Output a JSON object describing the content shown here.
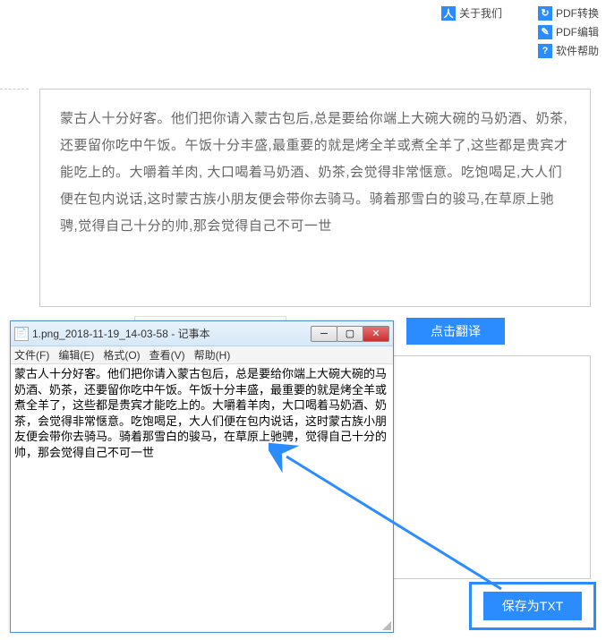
{
  "topButtons": {
    "left": {
      "icon": "人",
      "label": "关于我们"
    },
    "right": [
      {
        "icon": "↻",
        "label": "PDF转换"
      },
      {
        "icon": "✎",
        "label": "PDF编辑"
      },
      {
        "icon": "?",
        "label": "软件帮助"
      }
    ]
  },
  "mainText": "蒙古人十分好客。他们把你请入蒙古包后,总是要给你端上大碗大碗的马奶酒、奶茶,还要留你吃中午饭。午饭十分丰盛,最重要的就是烤全羊或煮全羊了,这些都是贵宾才能吃上的。大嚼着羊肉, 大口喝着马奶酒、奶茶,会觉得非常惬意。吃饱喝足,大人们便在包内说话,这时蒙古族小朋友便会带你去骑马。骑着那雪白的骏马,在草原上驰骋,觉得自己十分的帅,那会觉得自己不可一世",
  "translateBtn": "点击翻译",
  "saveBtn": "保存为TXT",
  "notepad": {
    "title": "1.png_2018-11-19_14-03-58 - 记事本",
    "menus": [
      "文件(F)",
      "编辑(E)",
      "格式(O)",
      "查看(V)",
      "帮助(H)"
    ],
    "content": "蒙古人十分好客。他们把你请入蒙古包后，总是要给你端上大碗大碗的马奶酒、奶茶，还要留你吃中午饭。午饭十分丰盛，最重要的就是烤全羊或煮全羊了，这些都是贵宾才能吃上的。大嚼着羊肉，大口喝着马奶酒、奶茶，会觉得非常惬意。吃饱喝足，大人们便在包内说话，这时蒙古族小朋友便会带你去骑马。骑着那雪白的骏马，在草原上驰骋，觉得自己十分的帅，那会觉得自己不可一世"
  }
}
